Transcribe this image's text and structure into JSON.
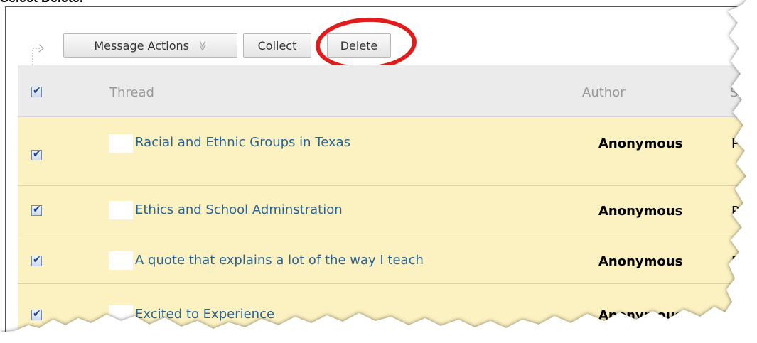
{
  "caption": "Select Delete.",
  "toolbar": {
    "message_actions_label": "Message Actions",
    "message_actions_chevron": "≫",
    "collect_label": "Collect",
    "delete_label": "Delete"
  },
  "table": {
    "headers": {
      "thread": "Thread",
      "author": "Author",
      "status": "St"
    },
    "rows": [
      {
        "checked": true,
        "title": "Racial and Ethnic Groups in Texas",
        "author": "Anonymous",
        "status": "P"
      },
      {
        "checked": true,
        "title": "Ethics and School Adminstration",
        "author": "Anonymous",
        "status": "P"
      },
      {
        "checked": true,
        "title": "A quote that explains a lot of the way I teach",
        "author": "Anonymous",
        "status": "P"
      },
      {
        "checked": true,
        "title": "Excited to Experience",
        "author": "Anonymous",
        "status": ""
      }
    ]
  },
  "colors": {
    "highlight": "#e21b1b",
    "row_bg": "#fcf1c0",
    "link": "#2a6496"
  }
}
